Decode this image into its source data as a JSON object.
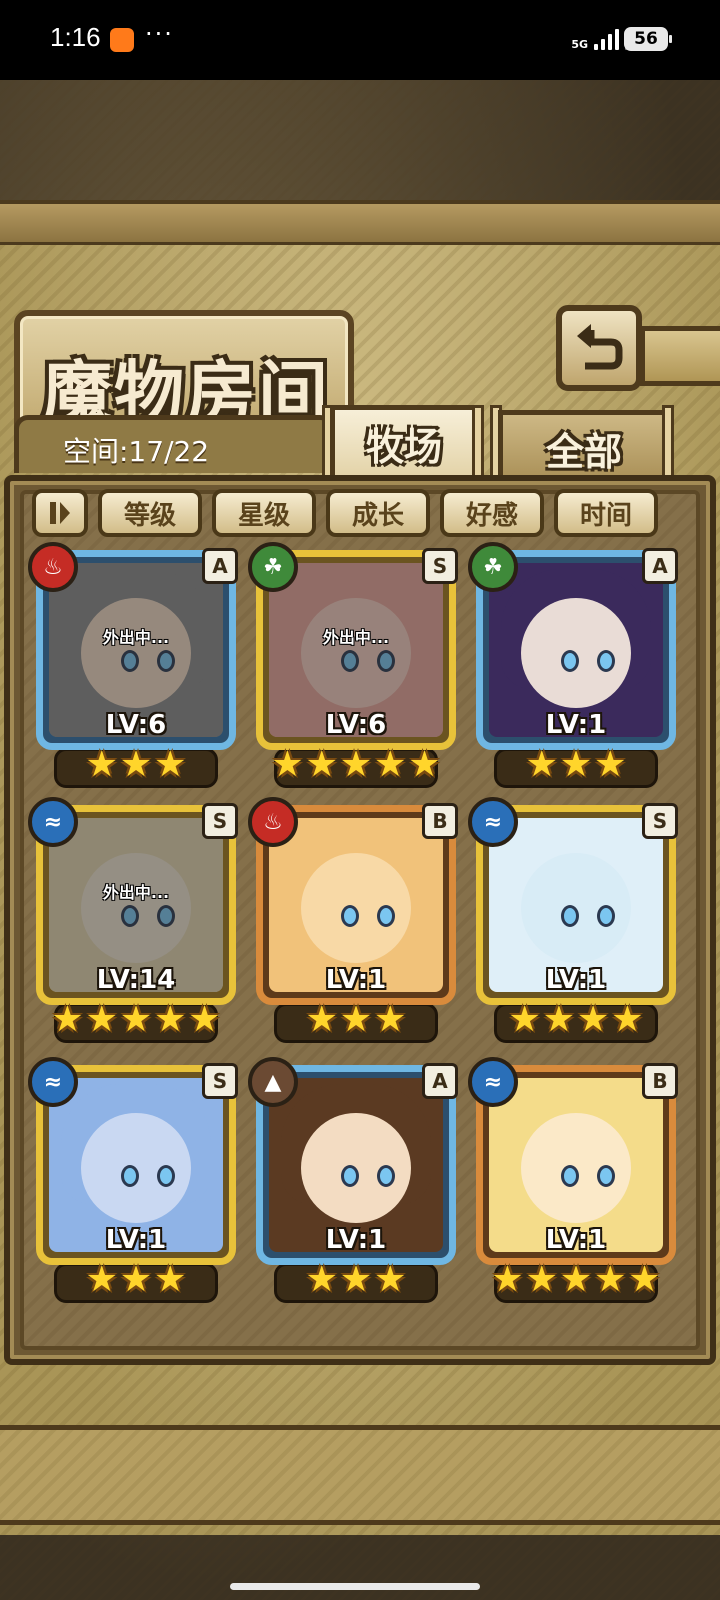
{
  "status_bar": {
    "time": "1:16",
    "more": "···",
    "network": "5G",
    "battery": "56"
  },
  "header": {
    "title": "魔物房间",
    "back_icon": "return-arrow-icon"
  },
  "info": {
    "space_label": "空间:17/22"
  },
  "tabs": [
    {
      "label": "牧场",
      "active": true
    },
    {
      "label": "全部",
      "active": false
    }
  ],
  "sort_bar": {
    "toggle_icon": "pause-sort-toggle-icon",
    "buttons": [
      "等级",
      "星级",
      "成长",
      "好感",
      "时间"
    ]
  },
  "monsters": [
    {
      "element": "fire",
      "rank": "A",
      "level": "LV:6",
      "stars": 3,
      "away": "外出中..."
    },
    {
      "element": "grass",
      "rank": "S",
      "level": "LV:6",
      "stars": 5,
      "away": "外出中..."
    },
    {
      "element": "grass",
      "rank": "A",
      "level": "LV:1",
      "stars": 3,
      "away": ""
    },
    {
      "element": "water",
      "rank": "S",
      "level": "LV:14",
      "stars": 5,
      "away": "外出中..."
    },
    {
      "element": "fire",
      "rank": "B",
      "level": "LV:1",
      "stars": 3,
      "away": ""
    },
    {
      "element": "water",
      "rank": "S",
      "level": "LV:1",
      "stars": 4,
      "away": ""
    },
    {
      "element": "water",
      "rank": "S",
      "level": "LV:1",
      "stars": 3,
      "away": ""
    },
    {
      "element": "earth",
      "rank": "A",
      "level": "LV:1",
      "stars": 3,
      "away": ""
    },
    {
      "element": "water",
      "rank": "B",
      "level": "LV:1",
      "stars": 5,
      "away": ""
    }
  ],
  "colors": {
    "rank_A": "#6fb7e3",
    "rank_S": "#e8c23a",
    "rank_B": "#d98b3c",
    "fire": "#c52c25",
    "grass": "#3f8a3a",
    "water": "#2a6fb8",
    "earth": "#6b4a33"
  }
}
